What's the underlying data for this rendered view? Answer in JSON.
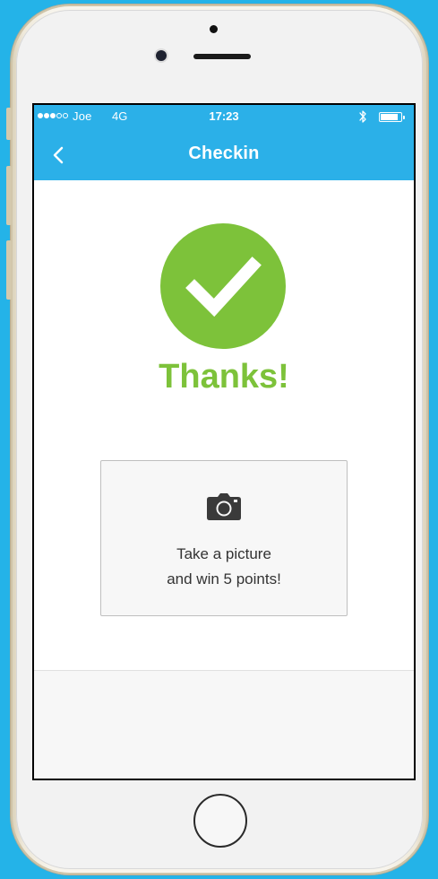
{
  "status_bar": {
    "carrier": "Joe",
    "network": "4G",
    "time": "17:23",
    "signal_bars_filled": 3,
    "signal_bars_total": 5,
    "bluetooth_icon": "bluetooth-icon",
    "battery_level": 0.9
  },
  "nav": {
    "title": "Checkin",
    "back_icon": "chevron-left-icon"
  },
  "success": {
    "icon": "checkmark-icon",
    "message": "Thanks!"
  },
  "photo_prompt": {
    "icon": "camera-icon",
    "line1": "Take a picture",
    "line2": "and win 5 points!"
  },
  "colors": {
    "background": "#24b3e8",
    "nav": "#2bb0e8",
    "accent_green": "#7dc23a",
    "card_bg": "#f7f7f7",
    "card_border": "#bfbfbf"
  }
}
